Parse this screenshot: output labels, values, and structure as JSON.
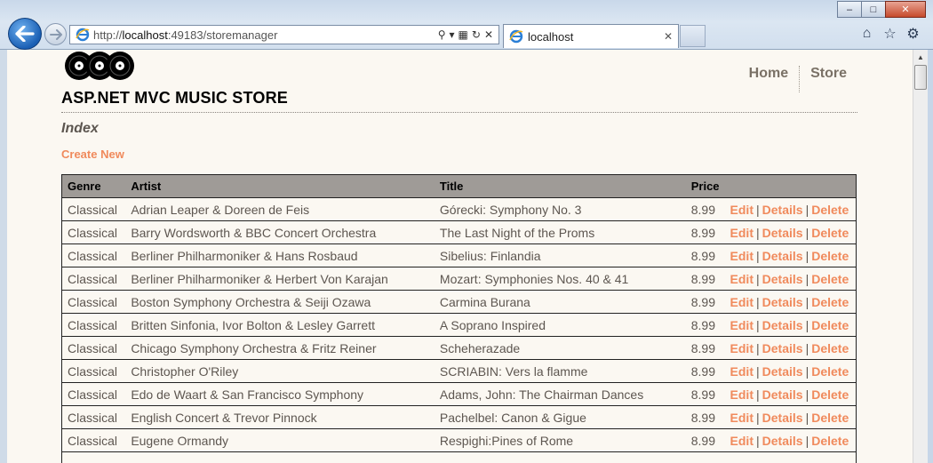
{
  "browser": {
    "address_url_prefix": "http://",
    "address_host": "localhost",
    "address_rest": ":49183/storemanager",
    "tab_title": "localhost"
  },
  "site": {
    "title": "ASP.NET MVC MUSIC STORE",
    "nav": [
      {
        "label": "Home"
      },
      {
        "label": "Store"
      }
    ]
  },
  "page": {
    "heading": "Index",
    "create_link": "Create New"
  },
  "table": {
    "headers": [
      "Genre",
      "Artist",
      "Title",
      "Price"
    ],
    "action_labels": {
      "edit": "Edit",
      "details": "Details",
      "delete": "Delete"
    },
    "rows": [
      {
        "genre": "Classical",
        "artist": "Adrian Leaper & Doreen de Feis",
        "title": "Górecki: Symphony No. 3",
        "price": "8.99"
      },
      {
        "genre": "Classical",
        "artist": "Barry Wordsworth & BBC Concert Orchestra",
        "title": "The Last Night of the Proms",
        "price": "8.99"
      },
      {
        "genre": "Classical",
        "artist": "Berliner Philharmoniker & Hans Rosbaud",
        "title": "Sibelius: Finlandia",
        "price": "8.99"
      },
      {
        "genre": "Classical",
        "artist": "Berliner Philharmoniker & Herbert Von Karajan",
        "title": "Mozart: Symphonies Nos. 40 & 41",
        "price": "8.99"
      },
      {
        "genre": "Classical",
        "artist": "Boston Symphony Orchestra & Seiji Ozawa",
        "title": "Carmina Burana",
        "price": "8.99"
      },
      {
        "genre": "Classical",
        "artist": "Britten Sinfonia, Ivor Bolton & Lesley Garrett",
        "title": "A Soprano Inspired",
        "price": "8.99"
      },
      {
        "genre": "Classical",
        "artist": "Chicago Symphony Orchestra & Fritz Reiner",
        "title": "Scheherazade",
        "price": "8.99"
      },
      {
        "genre": "Classical",
        "artist": "Christopher O'Riley",
        "title": "SCRIABIN: Vers la flamme",
        "price": "8.99"
      },
      {
        "genre": "Classical",
        "artist": "Edo de Waart & San Francisco Symphony",
        "title": "Adams, John: The Chairman Dances",
        "price": "8.99"
      },
      {
        "genre": "Classical",
        "artist": "English Concert & Trevor Pinnock",
        "title": "Pachelbel: Canon & Gigue",
        "price": "8.99"
      },
      {
        "genre": "Classical",
        "artist": "Eugene Ormandy",
        "title": "Respighi:Pines of Rome",
        "price": "8.99"
      },
      {
        "genre": "",
        "artist": "",
        "title": "",
        "price": ""
      }
    ]
  },
  "colors": {
    "link": "#f08a5c",
    "page_bg": "#fbf8f2",
    "header_bg": "#9f9b97",
    "text": "#5d5650"
  }
}
